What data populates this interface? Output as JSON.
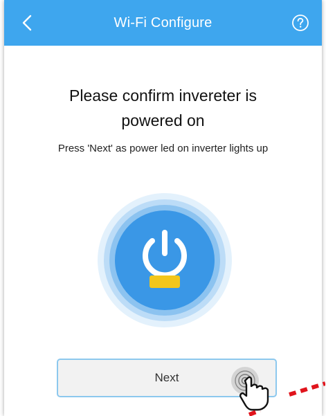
{
  "header": {
    "title": "Wi-Fi Configure",
    "back_icon": "chevron-left-icon",
    "help_icon": "question-circle-icon",
    "background_color": "#3ea6ee"
  },
  "main": {
    "headline_line1": "Please confirm invereter is",
    "headline_line2": "powered on",
    "instruction": "Press 'Next' as power led on inverter lights up",
    "power_icon": "power-icon",
    "led_color": "#f3c61b",
    "circle_color": "#3a97e6"
  },
  "footer": {
    "next_label": "Next",
    "tap_icon": "hand-pointer-icon",
    "annotation_color": "#e0141c"
  }
}
